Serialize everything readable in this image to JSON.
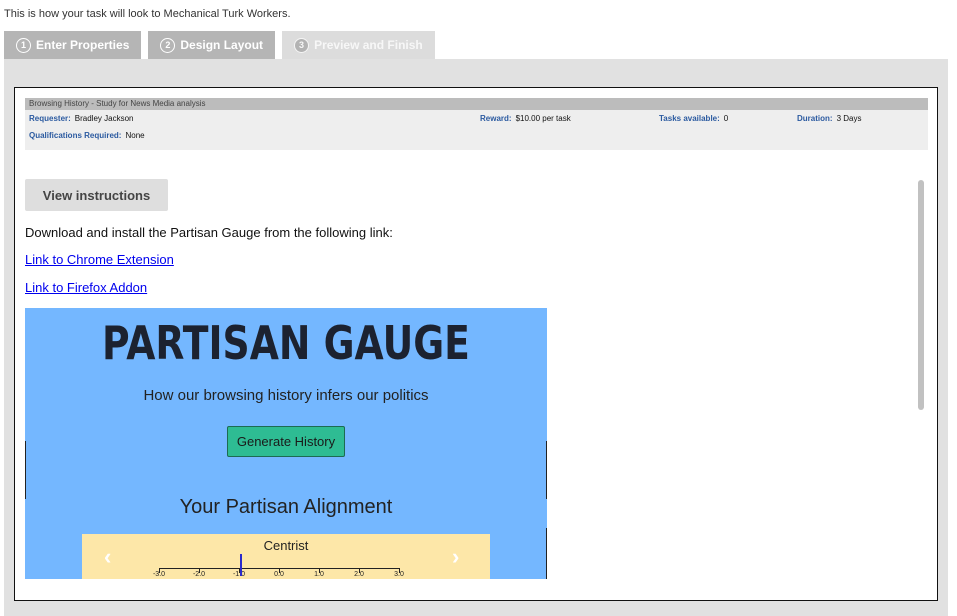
{
  "intro": "This is how your task will look to Mechanical Turk Workers.",
  "steps": [
    {
      "num": "1",
      "label": "Enter Properties"
    },
    {
      "num": "2",
      "label": "Design Layout"
    },
    {
      "num": "3",
      "label": "Preview and Finish"
    }
  ],
  "hit": {
    "title": "Browsing History - Study for News Media analysis",
    "requester_label": "Requester:",
    "requester": "Bradley Jackson",
    "reward_label": "Reward:",
    "reward": "$10.00 per task",
    "tasks_label": "Tasks available:",
    "tasks": "0",
    "duration_label": "Duration:",
    "duration": "3 Days",
    "quals_label": "Qualifications Required:",
    "quals": "None"
  },
  "content": {
    "instructions_button": "View instructions",
    "download_text": "Download and install the Partisan Gauge from the following link:",
    "chrome_link": "Link to Chrome Extension",
    "firefox_link": "Link to Firefox Addon"
  },
  "banner": {
    "title": "PARTISAN GAUGE",
    "subtitle": "How our browsing history infers our politics",
    "generate_button": "Generate History",
    "alignment_title": "Your Partisan Alignment",
    "gauge_label": "Centrist",
    "ticks": [
      "-3.0",
      "-2.0",
      "-1.0",
      "0.0",
      "1.0",
      "2.0",
      "3.0"
    ],
    "marker_value": -1.0,
    "prev_icon": "chevron-left-icon",
    "next_icon": "chevron-right-icon"
  }
}
